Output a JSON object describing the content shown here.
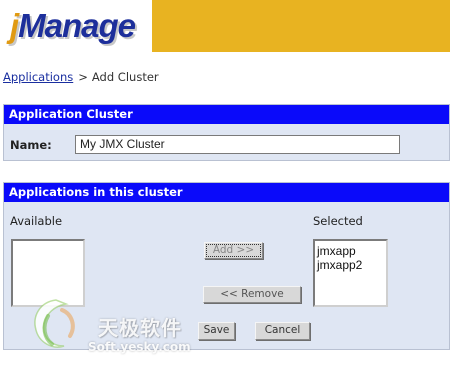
{
  "header": {
    "logo_j": "j",
    "logo_rest": "Manage"
  },
  "breadcrumb": {
    "link": "Applications",
    "separator": ">",
    "current": "Add Cluster"
  },
  "cluster_panel": {
    "title": "Application Cluster",
    "name_label": "Name:",
    "name_value": "My JMX Cluster"
  },
  "apps_panel": {
    "title": "Applications in this cluster",
    "available_label": "Available",
    "selected_label": "Selected",
    "available_items": [],
    "selected_items": [
      "jmxapp",
      "jmxapp2"
    ],
    "add_button": "Add >>",
    "remove_button": "<< Remove",
    "save_button": "Save",
    "cancel_button": "Cancel"
  },
  "watermark": {
    "text_cn": "天极软件",
    "url": "Soft.yesky.com"
  },
  "colors": {
    "banner": "#e8b321",
    "panel_header": "#0a0afa",
    "panel_body": "#dfe6f3",
    "logo_blue": "#1d2f9b"
  }
}
